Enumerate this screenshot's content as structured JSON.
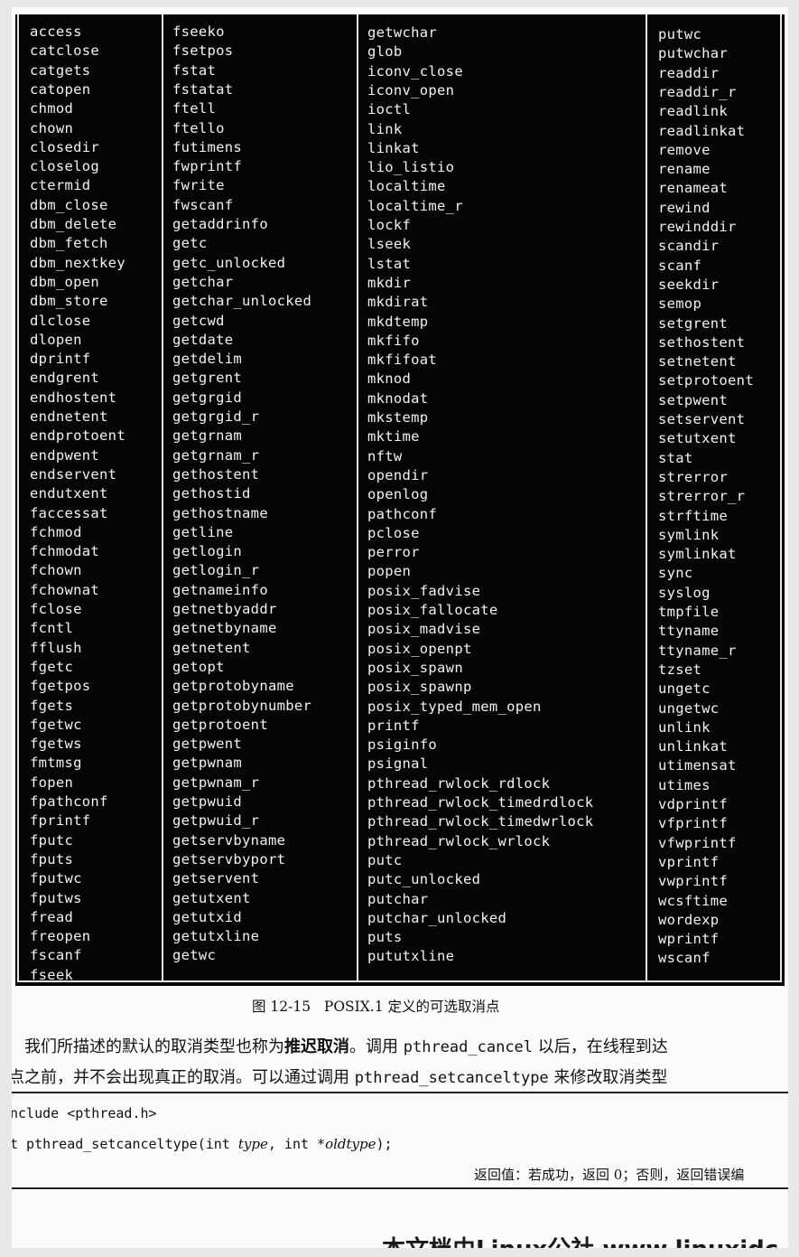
{
  "table": {
    "columns": [
      [
        "access",
        "catclose",
        "catgets",
        "catopen",
        "chmod",
        "chown",
        "closedir",
        "closelog",
        "ctermid",
        "dbm_close",
        "dbm_delete",
        "dbm_fetch",
        "dbm_nextkey",
        "dbm_open",
        "dbm_store",
        "dlclose",
        "dlopen",
        "dprintf",
        "endgrent",
        "endhostent",
        "endnetent",
        "endprotoent",
        "endpwent",
        "endservent",
        "endutxent",
        "faccessat",
        "fchmod",
        "fchmodat",
        "fchown",
        "fchownat",
        "fclose",
        "fcntl",
        "fflush",
        "fgetc",
        "fgetpos",
        "fgets",
        "fgetwc",
        "fgetws",
        "fmtmsg",
        "fopen",
        "fpathconf",
        "fprintf",
        "fputc",
        "fputs",
        "fputwc",
        "fputws",
        "fread",
        "freopen",
        "fscanf",
        "fseek"
      ],
      [
        "fseeko",
        "fsetpos",
        "fstat",
        "fstatat",
        "ftell",
        "ftello",
        "futimens",
        "fwprintf",
        "fwrite",
        "fwscanf",
        "getaddrinfo",
        "getc",
        "getc_unlocked",
        "getchar",
        "getchar_unlocked",
        "getcwd",
        "getdate",
        "getdelim",
        "getgrent",
        "getgrgid",
        "getgrgid_r",
        "getgrnam",
        "getgrnam_r",
        "gethostent",
        "gethostid",
        "gethostname",
        "getline",
        "getlogin",
        "getlogin_r",
        "getnameinfo",
        "getnetbyaddr",
        "getnetbyname",
        "getnetent",
        "getopt",
        "getprotobyname",
        "getprotobynumber",
        "getprotoent",
        "getpwent",
        "getpwnam",
        "getpwnam_r",
        "getpwuid",
        "getpwuid_r",
        "getservbyname",
        "getservbyport",
        "getservent",
        "getutxent",
        "getutxid",
        "getutxline",
        "getwc"
      ],
      [
        "getwchar",
        "glob",
        "iconv_close",
        "iconv_open",
        "ioctl",
        "link",
        "linkat",
        "lio_listio",
        "localtime",
        "localtime_r",
        "lockf",
        "lseek",
        "lstat",
        "mkdir",
        "mkdirat",
        "mkdtemp",
        "mkfifo",
        "mkfifoat",
        "mknod",
        "mknodat",
        "mkstemp",
        "mktime",
        "nftw",
        "opendir",
        "openlog",
        "pathconf",
        "pclose",
        "perror",
        "popen",
        "posix_fadvise",
        "posix_fallocate",
        "posix_madvise",
        "posix_openpt",
        "posix_spawn",
        "posix_spawnp",
        "posix_typed_mem_open",
        "printf",
        "psiginfo",
        "psignal",
        "pthread_rwlock_rdlock",
        "pthread_rwlock_timedrdlock",
        "pthread_rwlock_timedwrlock",
        "pthread_rwlock_wrlock",
        "putc",
        "putc_unlocked",
        "putchar",
        "putchar_unlocked",
        "puts",
        "pututxline"
      ],
      [
        "putwc",
        "putwchar",
        "readdir",
        "readdir_r",
        "readlink",
        "readlinkat",
        "remove",
        "rename",
        "renameat",
        "rewind",
        "rewinddir",
        "scandir",
        "scanf",
        "seekdir",
        "semop",
        "setgrent",
        "sethostent",
        "setnetent",
        "setprotoent",
        "setpwent",
        "setservent",
        "setutxent",
        "stat",
        "strerror",
        "strerror_r",
        "strftime",
        "symlink",
        "symlinkat",
        "sync",
        "syslog",
        "tmpfile",
        "ttyname",
        "ttyname_r",
        "tzset",
        "ungetc",
        "ungetwc",
        "unlink",
        "unlinkat",
        "utimensat",
        "utimes",
        "vdprintf",
        "vfprintf",
        "vfwprintf",
        "vprintf",
        "vwprintf",
        "wcsftime",
        "wordexp",
        "wprintf",
        "wscanf"
      ]
    ]
  },
  "caption": "图 12-15   POSIX.1 定义的可选取消点",
  "para1": {
    "a": "我们所描述的默认的取消类型也称为",
    "b": "推迟取消",
    "c": "。调用 ",
    "d": "pthread_cancel",
    "e": " 以后，在线程到达"
  },
  "para2": {
    "a": "点之前，并不会出现真正的取消。可以通过调用 ",
    "b": "pthread_setcanceltype",
    "c": " 来修改取消类型"
  },
  "code": {
    "line1": "nclude <pthread.h>",
    "line2a": "t pthread_setcanceltype(int ",
    "line2b": "type",
    "line2c": ", int *",
    "line2d": "oldtype",
    "line2e": ");"
  },
  "return_line": "返回值：若成功，返回 0；否则，返回错误编",
  "watermark": "本文档由Linux公社 www.linuxidc.c"
}
